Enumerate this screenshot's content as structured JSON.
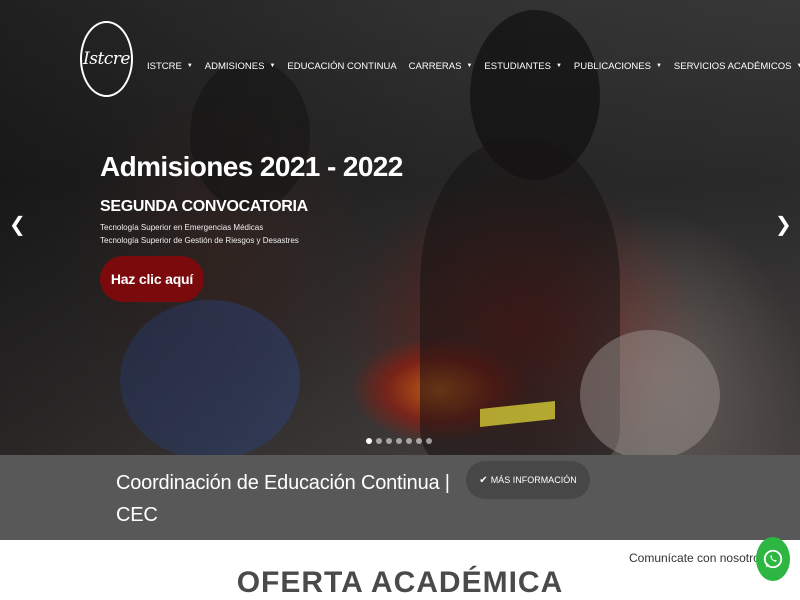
{
  "brand": {
    "logo_text": "Istcre"
  },
  "nav": {
    "items": [
      {
        "label": "ISTCRE",
        "has_dropdown": true
      },
      {
        "label": "ADMISIONES",
        "has_dropdown": true
      },
      {
        "label": "EDUCACIÓN CONTINUA",
        "has_dropdown": false
      },
      {
        "label": "CARRERAS",
        "has_dropdown": true
      },
      {
        "label": "ESTUDIANTES",
        "has_dropdown": true
      },
      {
        "label": "PUBLICACIONES",
        "has_dropdown": true
      },
      {
        "label": "SERVICIOS ACADÉMICOS",
        "has_dropdown": true
      }
    ],
    "caret": "▼"
  },
  "hero": {
    "title": "Admisiones 2021 - 2022",
    "subtitle": "SEGUNDA CONVOCATORIA",
    "lines": [
      "Tecnología Superior en Emergencias Médicas",
      "Tecnología Superior de Gestión de Riesgos y Desastres"
    ],
    "cta_label": "Haz clic aquí",
    "prev_arrow": "❮",
    "next_arrow": "❯",
    "slide_count": 7,
    "active_slide": 1
  },
  "banner": {
    "text": "Coordinación de Educación Continua | CEC",
    "button_icon": "✔",
    "button_label": "MÁS INFORMACIÓN"
  },
  "section": {
    "title": "OFERTA ACADÉMICA"
  },
  "contact": {
    "label": "Comunícate con nosotros",
    "icon": "whatsapp-icon"
  },
  "colors": {
    "cta_background": "#7a0a0c",
    "banner_background": "#585858",
    "info_button_background": "#474747",
    "whatsapp_green": "#2db742"
  }
}
